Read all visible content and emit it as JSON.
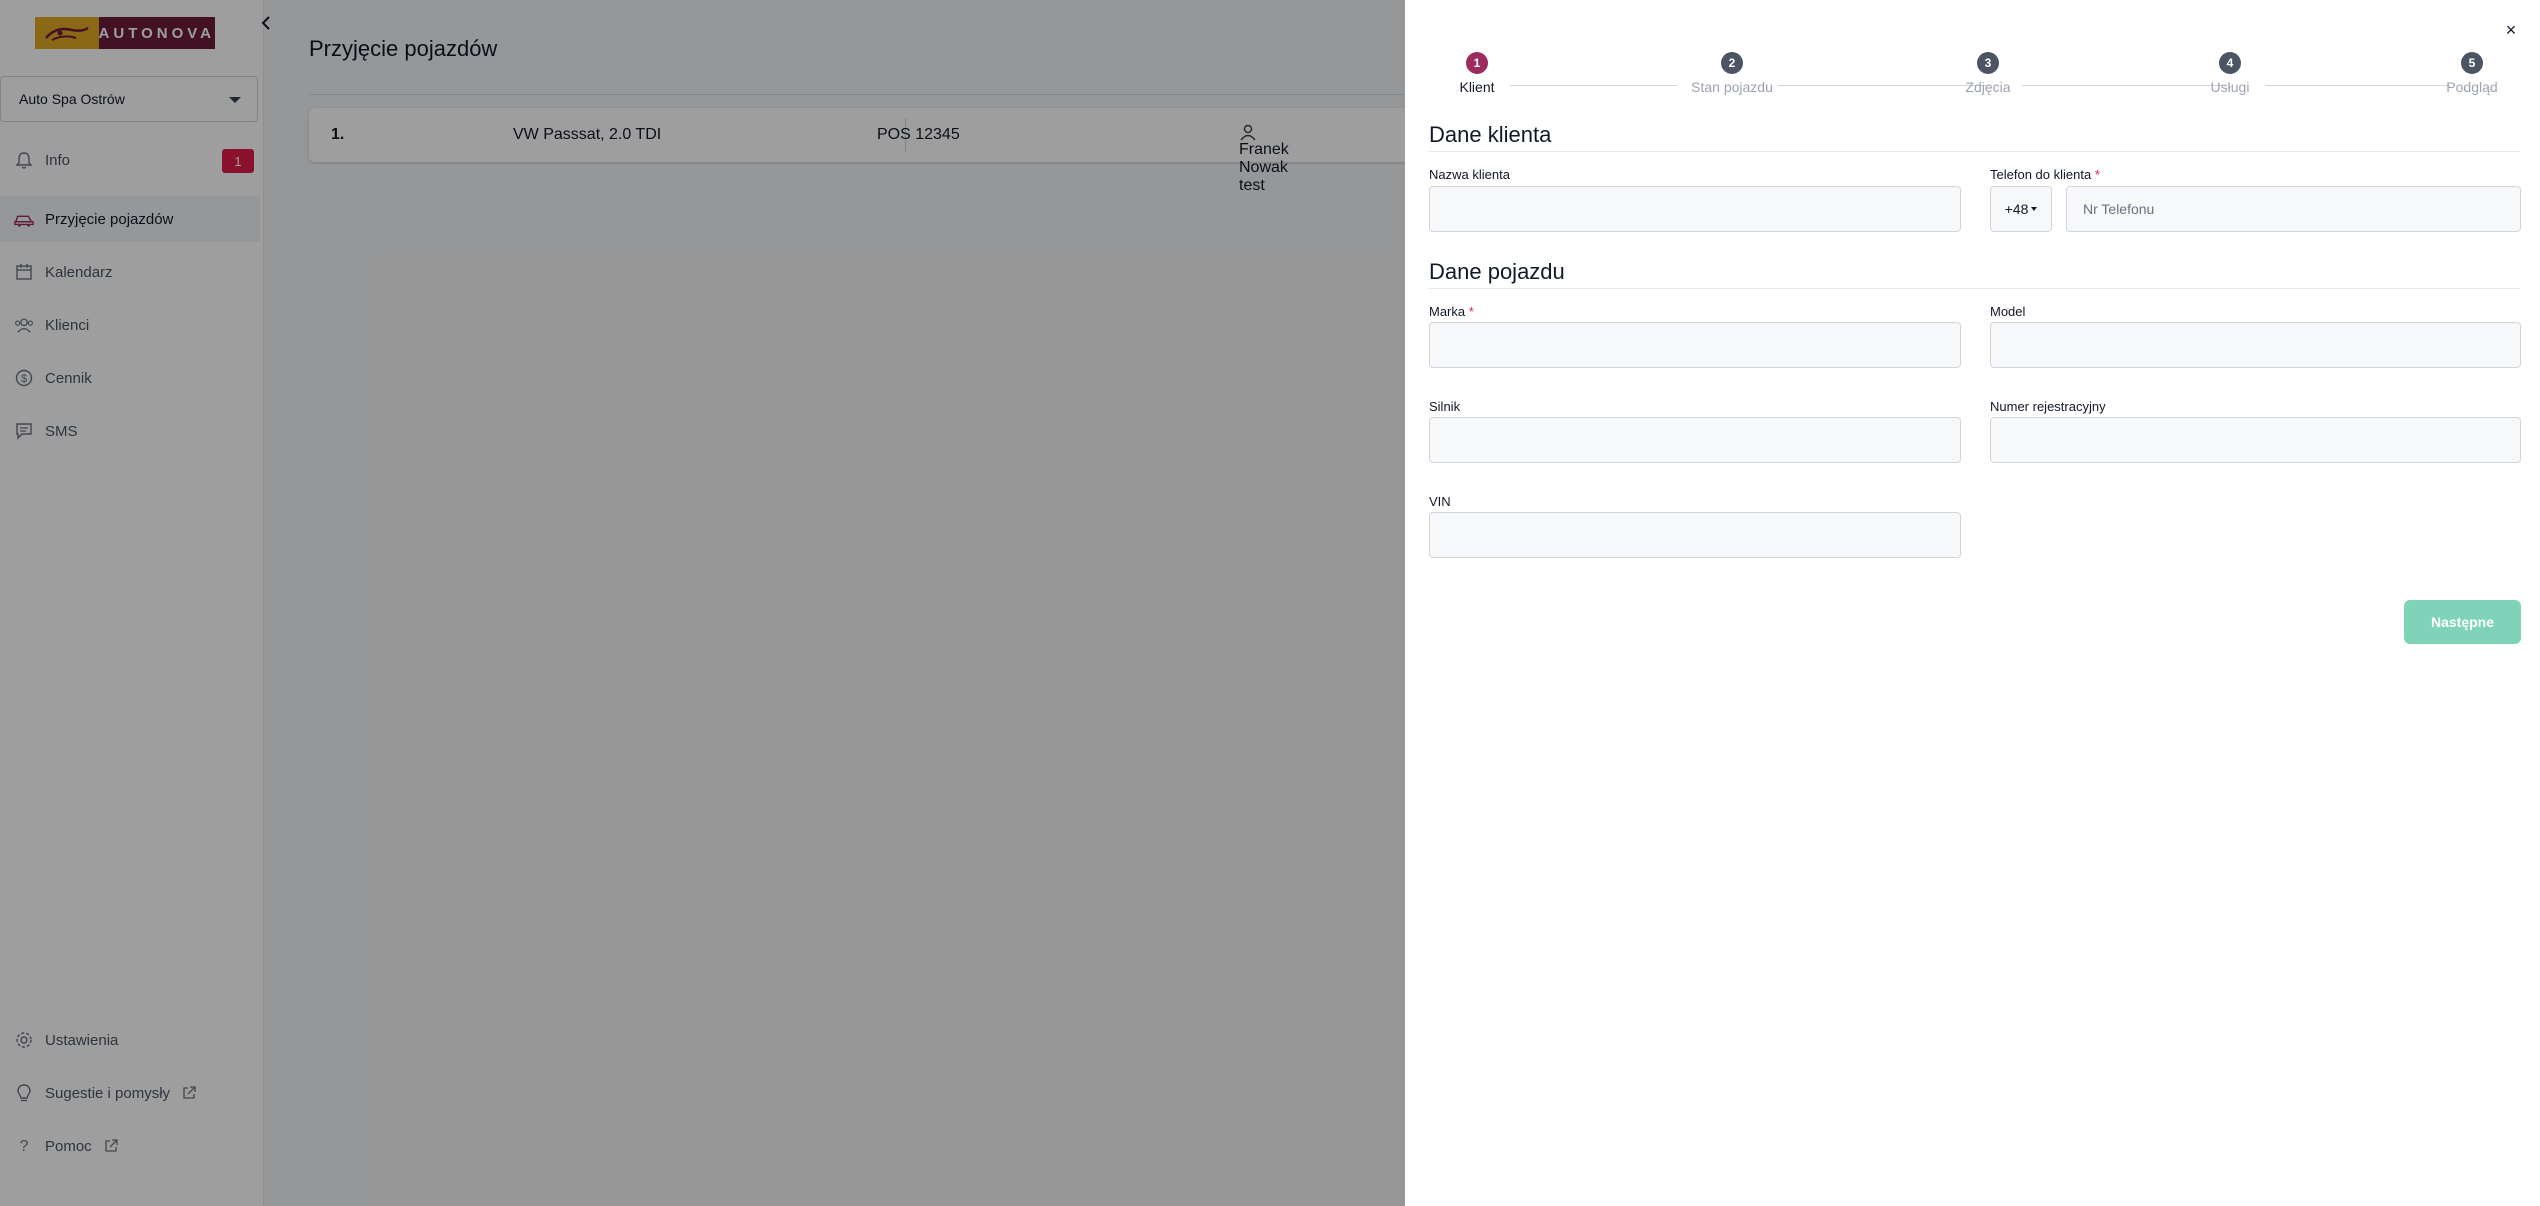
{
  "sidebar": {
    "logo_text": "AUTONOVA",
    "location": "Auto Spa Ostrów",
    "items": [
      {
        "label": "Info",
        "badge": "1"
      },
      {
        "label": "Przyjęcie pojazdów"
      },
      {
        "label": "Kalendarz"
      },
      {
        "label": "Klienci"
      },
      {
        "label": "Cennik"
      },
      {
        "label": "SMS"
      }
    ],
    "bottom_items": [
      {
        "label": "Ustawienia"
      },
      {
        "label": "Sugestie i pomysły"
      },
      {
        "label": "Pomoc"
      }
    ]
  },
  "main": {
    "title": "Przyjęcie pojazdów",
    "rows": [
      {
        "index": "1.",
        "vehicle": "VW Passsat, 2.0 TDI",
        "plate": "POS 12345",
        "owner": "Franek Nowak test"
      }
    ]
  },
  "drawer": {
    "steps": [
      {
        "num": "1",
        "label": "Klient"
      },
      {
        "num": "2",
        "label": "Stan pojazdu"
      },
      {
        "num": "3",
        "label": "Zdjęcia"
      },
      {
        "num": "4",
        "label": "Usługi"
      },
      {
        "num": "5",
        "label": "Podgląd"
      }
    ],
    "client_section": {
      "title": "Dane klienta",
      "name_label": "Nazwa klienta",
      "name_value": "",
      "phone_label": "Telefon do klienta",
      "phone_prefix": "+48",
      "phone_placeholder": "Nr Telefonu",
      "phone_value": ""
    },
    "vehicle_section": {
      "title": "Dane pojazdu",
      "make_label": "Marka",
      "model_label": "Model",
      "engine_label": "Silnik",
      "plate_label": "Numer rejestracyjny",
      "vin_label": "VIN"
    },
    "required_mark": "*",
    "close_glyph": "×",
    "next_label": "Następne"
  },
  "colors": {
    "accent": "#9b2c5d",
    "badge": "#e11d48",
    "next_button": "#7fd3b8",
    "logo_gold": "#e0a823",
    "logo_maroon": "#6d1c3a"
  }
}
